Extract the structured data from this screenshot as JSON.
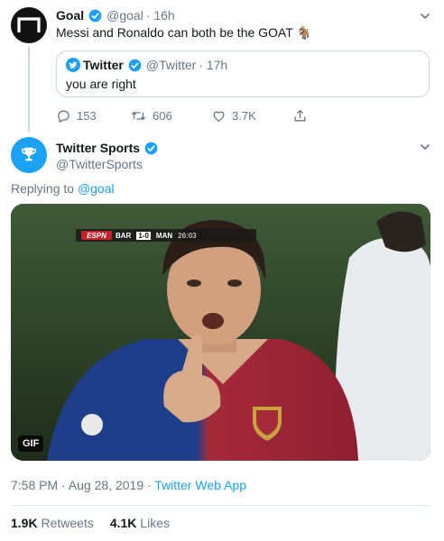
{
  "goal_tweet": {
    "name": "Goal",
    "handle": "@goal",
    "time": "· 16h",
    "text": "Messi and Ronaldo can both be the GOAT",
    "goat_emoji": "🐐"
  },
  "quoted_tweet": {
    "name": "Twitter",
    "handle": "@Twitter",
    "time": "· 17h",
    "text": "you are right"
  },
  "goal_actions": {
    "replies": "153",
    "retweets": "606",
    "likes": "3.7K"
  },
  "sports_tweet": {
    "name": "Twitter Sports",
    "handle": "@TwitterSports",
    "replying_prefix": "Replying to",
    "replying_handle": "@goal",
    "scoreboard": {
      "channel": "ESPN",
      "home": "BAR",
      "score": "1-0",
      "away": "MAN",
      "clock": "26:03"
    },
    "media_badge": "GIF",
    "timestamp": "7:58 PM · Aug 28, 2019 ·",
    "app": "Twitter Web App",
    "retweets_count": "1.9K",
    "retweets_label": "Retweets",
    "likes_count": "4.1K",
    "likes_label": "Likes"
  },
  "colors": {
    "accent": "#1da1f2",
    "text_primary": "#14171a",
    "text_secondary": "#657786",
    "border": "#ccd6dd"
  }
}
